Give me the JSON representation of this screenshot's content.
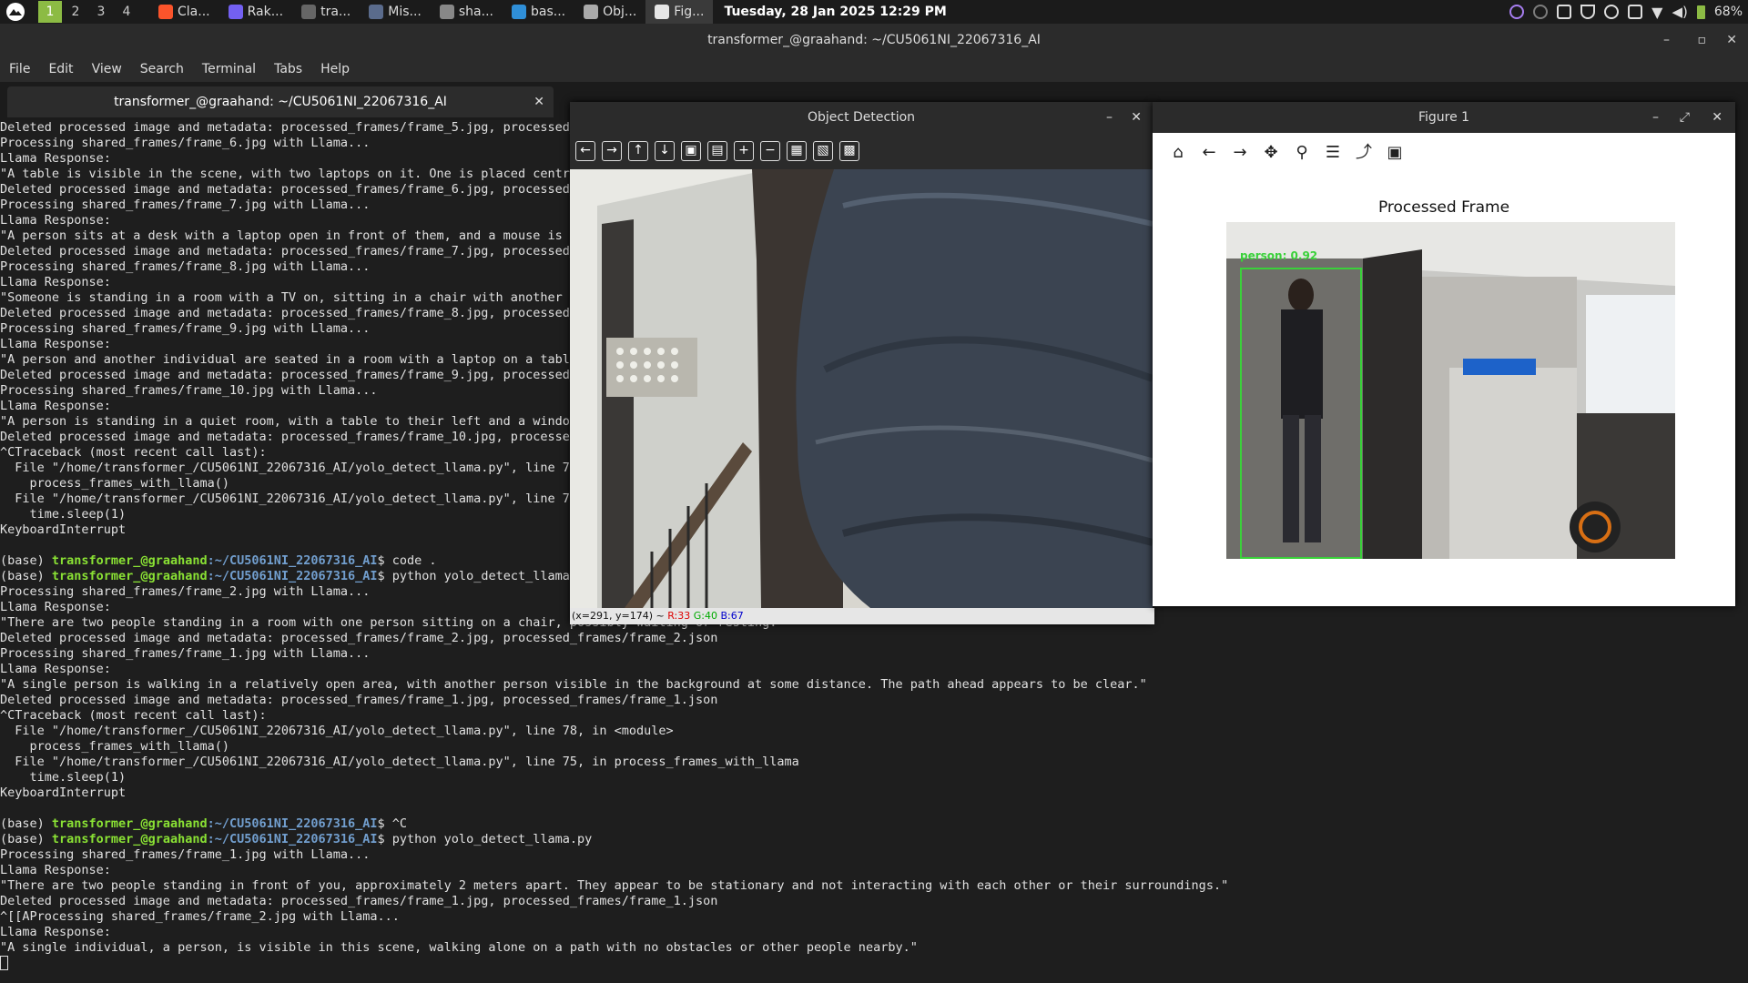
{
  "panel": {
    "workspaces": [
      "1",
      "2",
      "3",
      "4"
    ],
    "active_workspace": "1",
    "tasks": [
      {
        "label": "Cla...",
        "icon": "brave-icon",
        "color": "#fb542b"
      },
      {
        "label": "Rak...",
        "icon": "viber-icon",
        "color": "#7360f2"
      },
      {
        "label": "tra...",
        "icon": "terminal-icon",
        "color": "#666666"
      },
      {
        "label": "Mis...",
        "icon": "image-icon",
        "color": "#5a6b8c"
      },
      {
        "label": "sha...",
        "icon": "folder-icon",
        "color": "#888888"
      },
      {
        "label": "bas...",
        "icon": "vscode-icon",
        "color": "#2f8fd8"
      },
      {
        "label": "Obj...",
        "icon": "app-icon",
        "color": "#aaaaaa"
      },
      {
        "label": "Fig...",
        "icon": "figure-icon",
        "color": "#e6e6e6"
      }
    ],
    "clock": "Tuesday, 28 Jan 2025 12:29 PM",
    "battery": "68%"
  },
  "terminal": {
    "title": "transformer_@graahand: ~/CU5061NI_22067316_AI",
    "tab_title": "transformer_@graahand: ~/CU5061NI_22067316_AI",
    "menu": [
      "File",
      "Edit",
      "View",
      "Search",
      "Terminal",
      "Tabs",
      "Help"
    ],
    "lines": [
      {
        "t": "Deleted processed image and metadata: processed_frames/frame_5.jpg, processed_"
      },
      {
        "t": "Processing shared_frames/frame_6.jpg with Llama..."
      },
      {
        "t": "Llama Response:"
      },
      {
        "t": "\"A table is visible in the scene, with two laptops on it. One is placed centra"
      },
      {
        "t": "Deleted processed image and metadata: processed_frames/frame_6.jpg, processed_"
      },
      {
        "t": "Processing shared_frames/frame_7.jpg with Llama..."
      },
      {
        "t": "Llama Response:"
      },
      {
        "t": "\"A person sits at a desk with a laptop open in front of them, and a mouse is o"
      },
      {
        "t": "Deleted processed image and metadata: processed_frames/frame_7.jpg, processed_"
      },
      {
        "t": "Processing shared_frames/frame_8.jpg with Llama..."
      },
      {
        "t": "Llama Response:"
      },
      {
        "t": "\"Someone is standing in a room with a TV on, sitting in a chair with another p"
      },
      {
        "t": "Deleted processed image and metadata: processed_frames/frame_8.jpg, processed_"
      },
      {
        "t": "Processing shared_frames/frame_9.jpg with Llama..."
      },
      {
        "t": "Llama Response:"
      },
      {
        "t": "\"A person and another individual are seated in a room with a laptop on a table"
      },
      {
        "t": "Deleted processed image and metadata: processed_frames/frame_9.jpg, processed_"
      },
      {
        "t": "Processing shared_frames/frame_10.jpg with Llama..."
      },
      {
        "t": "Llama Response:"
      },
      {
        "t": "\"A person is standing in a quiet room, with a table to their left and a window"
      },
      {
        "t": "Deleted processed image and metadata: processed_frames/frame_10.jpg, processed"
      },
      {
        "t": "^CTraceback (most recent call last):"
      },
      {
        "t": "  File \"/home/transformer_/CU5061NI_22067316_AI/yolo_detect_llama.py\", line 78"
      },
      {
        "t": "    process_frames_with_llama()"
      },
      {
        "t": "  File \"/home/transformer_/CU5061NI_22067316_AI/yolo_detect_llama.py\", line 75"
      },
      {
        "t": "    time.sleep(1)"
      },
      {
        "t": "KeyboardInterrupt"
      },
      {
        "t": ""
      },
      {
        "p": true,
        "base": "(base) ",
        "user": "transformer_@graahand",
        "path": ":~/CU5061NI_22067316_AI",
        "t": "$ code ."
      },
      {
        "p": true,
        "base": "(base) ",
        "user": "transformer_@graahand",
        "path": ":~/CU5061NI_22067316_AI",
        "t": "$ python yolo_detect_llama."
      },
      {
        "t": "Processing shared_frames/frame_2.jpg with Llama..."
      },
      {
        "t": "Llama Response:"
      },
      {
        "t": "\"There are two people standing in a room with one person sitting on a chair, possibly waiting or resting.\""
      },
      {
        "t": "Deleted processed image and metadata: processed_frames/frame_2.jpg, processed_frames/frame_2.json"
      },
      {
        "t": "Processing shared_frames/frame_1.jpg with Llama..."
      },
      {
        "t": "Llama Response:"
      },
      {
        "t": "\"A single person is walking in a relatively open area, with another person visible in the background at some distance. The path ahead appears to be clear.\""
      },
      {
        "t": "Deleted processed image and metadata: processed_frames/frame_1.jpg, processed_frames/frame_1.json"
      },
      {
        "t": "^CTraceback (most recent call last):"
      },
      {
        "t": "  File \"/home/transformer_/CU5061NI_22067316_AI/yolo_detect_llama.py\", line 78, in <module>"
      },
      {
        "t": "    process_frames_with_llama()"
      },
      {
        "t": "  File \"/home/transformer_/CU5061NI_22067316_AI/yolo_detect_llama.py\", line 75, in process_frames_with_llama"
      },
      {
        "t": "    time.sleep(1)"
      },
      {
        "t": "KeyboardInterrupt"
      },
      {
        "t": ""
      },
      {
        "p": true,
        "base": "(base) ",
        "user": "transformer_@graahand",
        "path": ":~/CU5061NI_22067316_AI",
        "t": "$ ^C"
      },
      {
        "p": true,
        "base": "(base) ",
        "user": "transformer_@graahand",
        "path": ":~/CU5061NI_22067316_AI",
        "t": "$ python yolo_detect_llama.py"
      },
      {
        "t": "Processing shared_frames/frame_1.jpg with Llama..."
      },
      {
        "t": "Llama Response:"
      },
      {
        "t": "\"There are two people standing in front of you, approximately 2 meters apart. They appear to be stationary and not interacting with each other or their surroundings.\""
      },
      {
        "t": "Deleted processed image and metadata: processed_frames/frame_1.jpg, processed_frames/frame_1.json"
      },
      {
        "t": "^[[AProcessing shared_frames/frame_2.jpg with Llama..."
      },
      {
        "t": "Llama Response:"
      },
      {
        "t": "\"A single individual, a person, is visible in this scene, walking alone on a path with no obstacles or other people nearby.\""
      }
    ]
  },
  "object_detection": {
    "title": "Object Detection",
    "toolbar": [
      "arrow-left-icon",
      "arrow-right-icon",
      "arrow-up-icon",
      "arrow-down-icon",
      "zoom-fit-icon",
      "zoom-original-icon",
      "zoom-in-icon",
      "zoom-out-icon",
      "save-image-icon",
      "copy-icon",
      "properties-icon"
    ],
    "status_coords": "(x=291, y=174) ~ ",
    "status_r": "R:33",
    "status_g": "G:40",
    "status_b": "B:67"
  },
  "figure": {
    "title": "Figure 1",
    "toolbar": [
      "home-icon",
      "back-icon",
      "forward-icon",
      "pan-icon",
      "zoom-icon",
      "configure-subplots-icon",
      "edit-axis-icon",
      "save-icon"
    ],
    "plot_title": "Processed Frame",
    "detection_label": "person: 0.92",
    "box_color": "#3ad13a"
  }
}
